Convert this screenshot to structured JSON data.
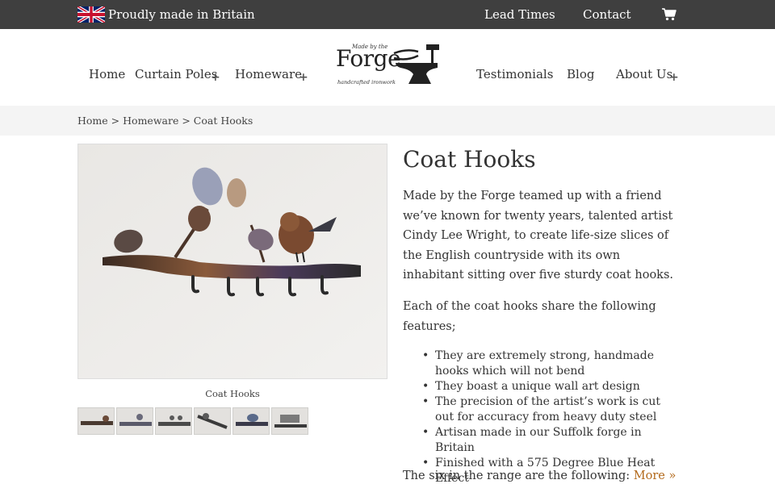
{
  "topbar": {
    "made_in": "Proudly made in Britain",
    "lead_times": "Lead Times",
    "contact": "Contact",
    "cart_icon": "shopping-cart-icon"
  },
  "nav": {
    "home": "Home",
    "curtain_poles": "Curtain Poles",
    "homeware": "Homeware",
    "testimonials": "Testimonials",
    "blog": "Blog",
    "about_us": "About Us",
    "expand_symbol": "+"
  },
  "logo": {
    "small_top": "Made by the",
    "forge": "Forge",
    "tagline": "handcrafted ironwork"
  },
  "breadcrumb": {
    "home": "Home",
    "separator": ">",
    "homeware": "Homeware",
    "current": "Coat Hooks"
  },
  "product": {
    "image_caption": "Coat Hooks",
    "thumbnail_count": 6,
    "title": "Coat Hooks",
    "intro": "Made by the Forge teamed up with a friend we’ve known for twenty years, talented artist Cindy Lee Wright, to create life-size slices of the English countryside with its own inhabitant sitting over five sturdy coat hooks.",
    "features_intro": "Each of the coat hooks share the following features;",
    "features": [
      "They are extremely strong, handmade hooks which will not bend",
      "They boast a unique wall art design",
      "The precision of the artist’s work is cut out for accuracy from heavy duty steel",
      "Artisan made in our Suffolk forge in Britain",
      "Finished with a 575 Degree Blue Heat Effect"
    ],
    "range_text": "The six in the range are the following:",
    "more_link": "More »"
  },
  "colors": {
    "topbar_bg": "#3f3f3f",
    "breadcrumb_bg": "#f4f4f4",
    "link_accent": "#b36a1c"
  }
}
